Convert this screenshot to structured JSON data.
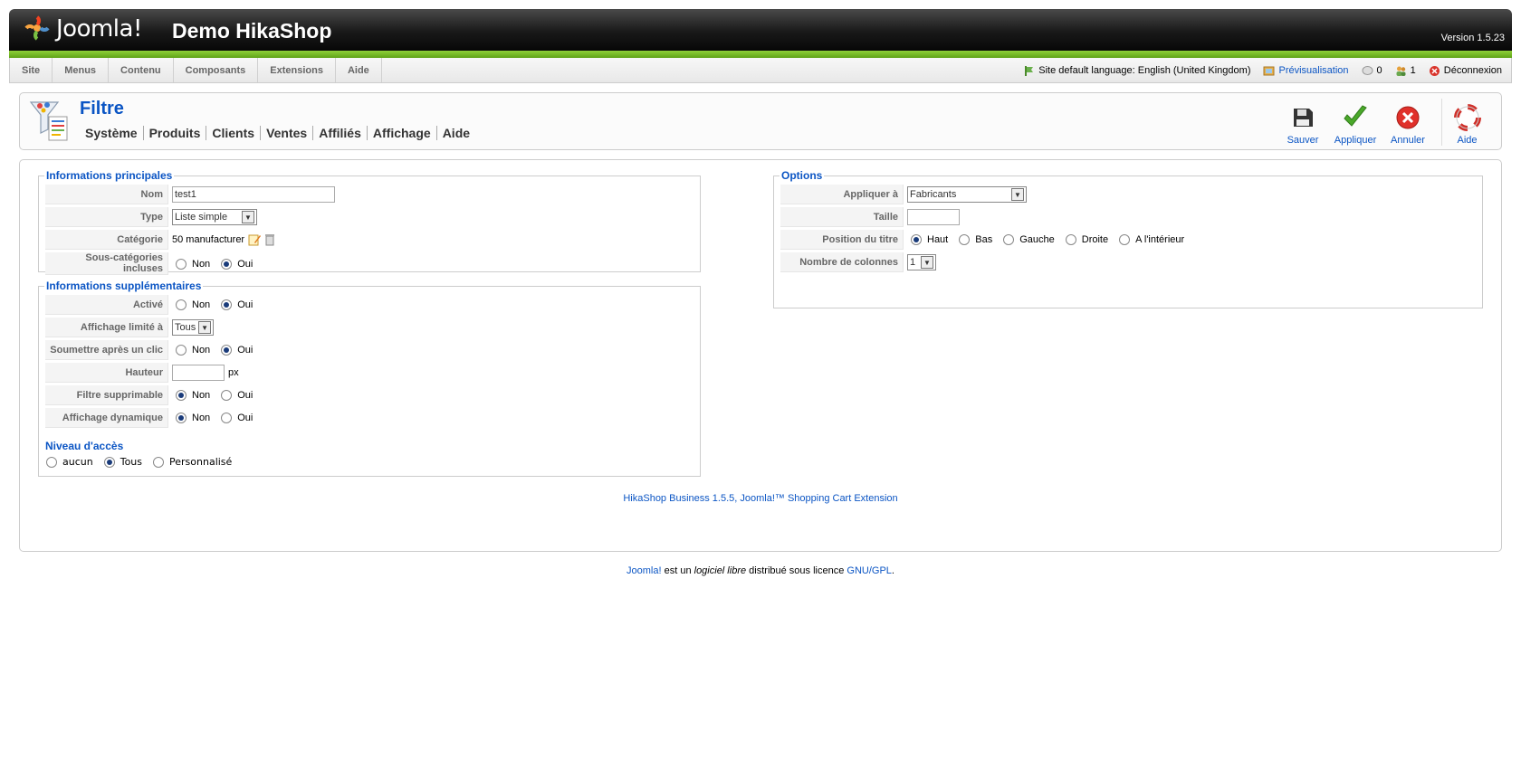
{
  "header": {
    "logo_text": "Joomla!",
    "site_title": "Demo HikaShop",
    "version": "Version 1.5.23"
  },
  "menu": [
    "Site",
    "Menus",
    "Contenu",
    "Composants",
    "Extensions",
    "Aide"
  ],
  "status": {
    "language": "Site default language: English (United Kingdom)",
    "preview": "Prévisualisation",
    "messages": "0",
    "users": "1",
    "logout": "Déconnexion"
  },
  "toolbar": {
    "title": "Filtre",
    "submenu": [
      "Système",
      "Produits",
      "Clients",
      "Ventes",
      "Affiliés",
      "Affichage",
      "Aide"
    ],
    "actions": {
      "save": "Sauver",
      "apply": "Appliquer",
      "cancel": "Annuler",
      "help": "Aide"
    }
  },
  "main_info": {
    "legend": "Informations principales",
    "name_label": "Nom",
    "name_value": "test1",
    "type_label": "Type",
    "type_value": "Liste simple",
    "category_label": "Catégorie",
    "category_value": "50 manufacturer",
    "subcat_label": "Sous-catégories incluses",
    "no": "Non",
    "yes": "Oui",
    "subcat_selected": "Oui"
  },
  "extra_info": {
    "legend": "Informations supplémentaires",
    "active_label": "Activé",
    "active_selected": "Oui",
    "limited_label": "Affichage limité à",
    "limited_value": "Tous",
    "submit_label": "Soumettre après un clic",
    "submit_selected": "Oui",
    "height_label": "Hauteur",
    "height_value": "",
    "height_unit": "px",
    "deletable_label": "Filtre supprimable",
    "deletable_selected": "Non",
    "dynamic_label": "Affichage dynamique",
    "dynamic_selected": "Non",
    "no": "Non",
    "yes": "Oui",
    "access_title": "Niveau d'accès",
    "access_options": [
      "aucun",
      "Tous",
      "Personnalisé"
    ],
    "access_selected": "Tous"
  },
  "options": {
    "legend": "Options",
    "apply_label": "Appliquer à",
    "apply_value": "Fabricants",
    "size_label": "Taille",
    "size_value": "",
    "title_pos_label": "Position du titre",
    "title_pos_options": [
      "Haut",
      "Bas",
      "Gauche",
      "Droite",
      "A l'intérieur"
    ],
    "title_pos_selected": "Haut",
    "columns_label": "Nombre de colonnes",
    "columns_value": "1"
  },
  "footer": {
    "hikashop": "HikaShop Business 1.5.5, Joomla!™ Shopping Cart Extension",
    "joomla_link": "Joomla!",
    "text1": " est un ",
    "text_italic": "logiciel libre",
    "text2": " distribué sous licence ",
    "license_link": "GNU/GPL",
    "text3": "."
  },
  "colors": {
    "accent": "#0b55c4",
    "green_bar": "#7bc225",
    "header_bg": "#000000"
  }
}
